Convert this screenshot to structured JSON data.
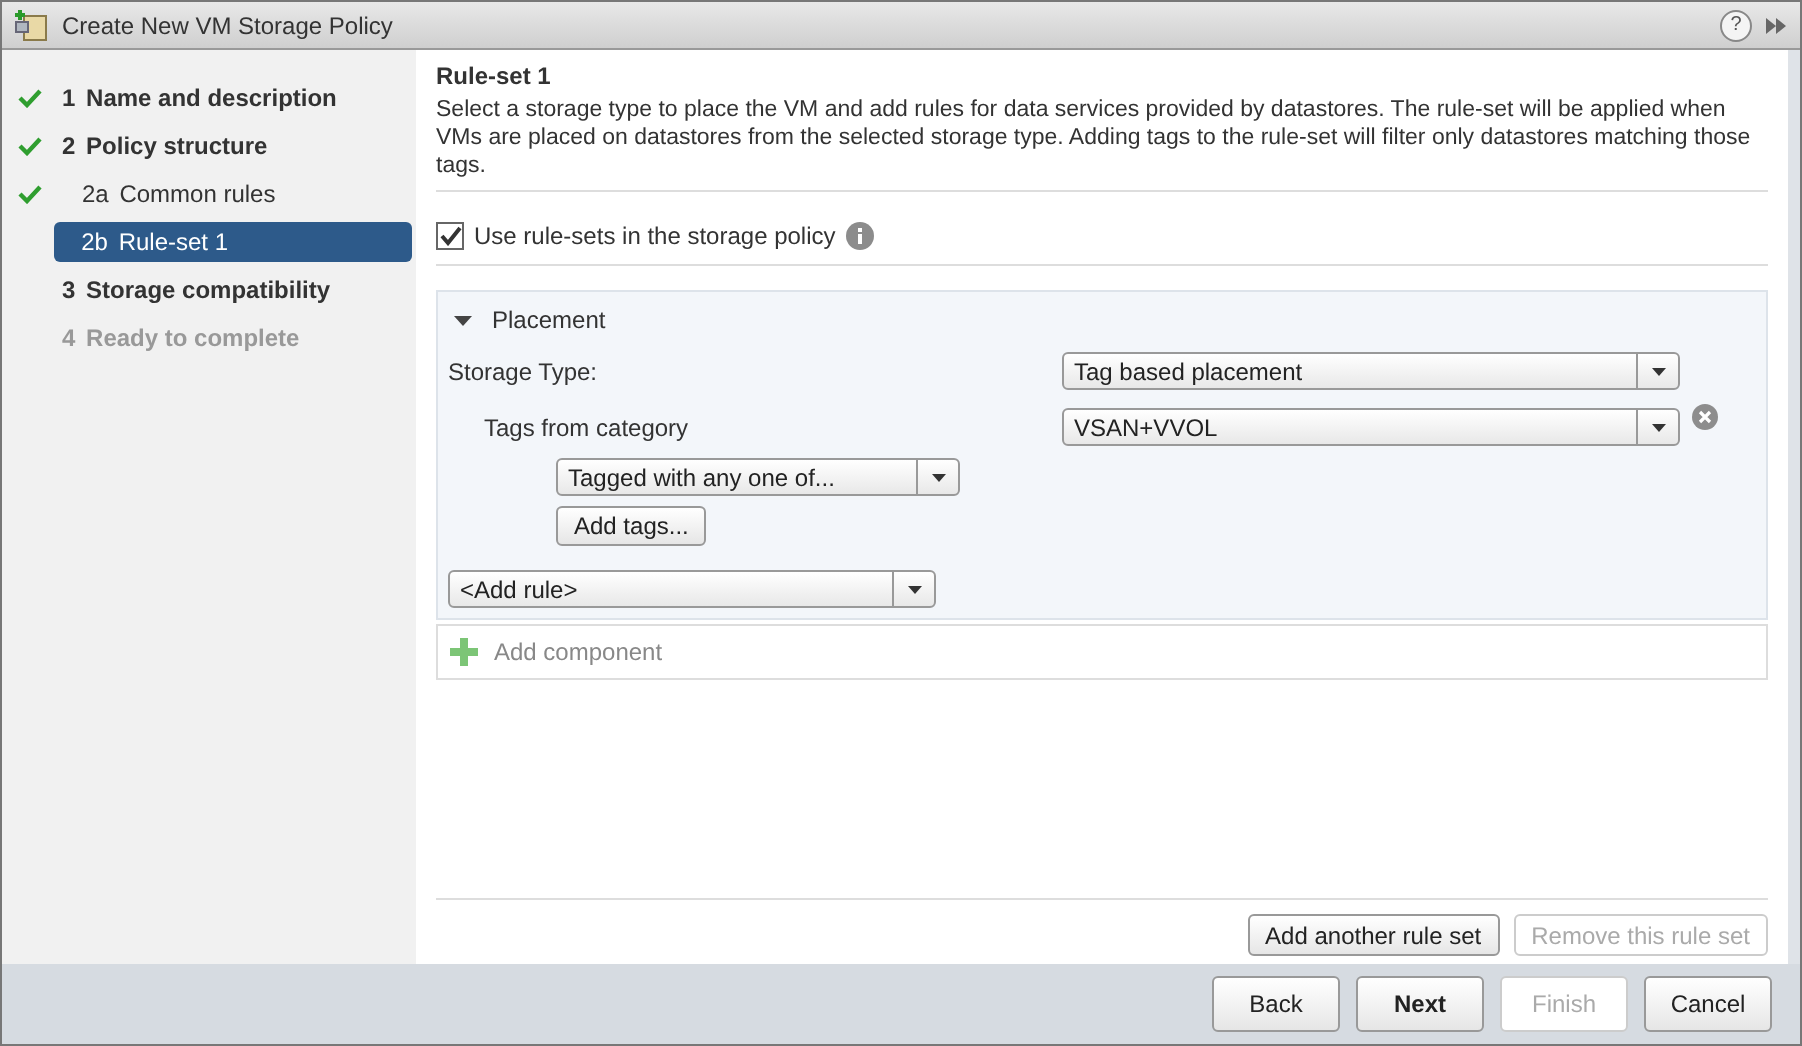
{
  "window": {
    "title": "Create New VM Storage Policy",
    "help": "?"
  },
  "steps": [
    {
      "number": "1",
      "label": "Name and description",
      "done": true,
      "selected": false,
      "disabled": false
    },
    {
      "number": "2",
      "label": "Policy structure",
      "done": true,
      "selected": false,
      "disabled": false,
      "children": [
        {
          "number": "2a",
          "label": "Common rules",
          "done": true,
          "selected": false,
          "disabled": false
        },
        {
          "number": "2b",
          "label": "Rule-set 1",
          "done": false,
          "selected": true,
          "disabled": false
        }
      ]
    },
    {
      "number": "3",
      "label": "Storage compatibility",
      "done": false,
      "selected": false,
      "disabled": false
    },
    {
      "number": "4",
      "label": "Ready to complete",
      "done": false,
      "selected": false,
      "disabled": true
    }
  ],
  "content": {
    "heading": "Rule-set 1",
    "description": "Select a storage type to place the VM and add rules for data services provided by datastores. The rule-set will be applied when VMs are placed on datastores from the selected storage type. Adding tags to the rule-set will filter only datastores matching those tags.",
    "use_rule_sets": {
      "label": "Use rule-sets in the storage policy",
      "checked": true
    },
    "placement": {
      "title": "Placement",
      "expanded": true,
      "storage_type_label": "Storage Type:",
      "storage_type": "Tag based placement",
      "tags_label": "Tags from category",
      "tags_category": "VSAN+VVOL",
      "tag_mode": "Tagged with any one of...",
      "add_tags": "Add tags...",
      "add_rule": "<Add rule>"
    },
    "add_component": "Add component",
    "rule_set_buttons": [
      {
        "label": "Add another rule set",
        "disabled": false
      },
      {
        "label": "Remove this rule set",
        "disabled": true
      }
    ]
  },
  "footer_buttons": [
    {
      "label": "Back",
      "disabled": false,
      "primary": false
    },
    {
      "label": "Next",
      "disabled": false,
      "primary": true
    },
    {
      "label": "Finish",
      "disabled": true,
      "primary": false
    },
    {
      "label": "Cancel",
      "disabled": false,
      "primary": false
    }
  ]
}
